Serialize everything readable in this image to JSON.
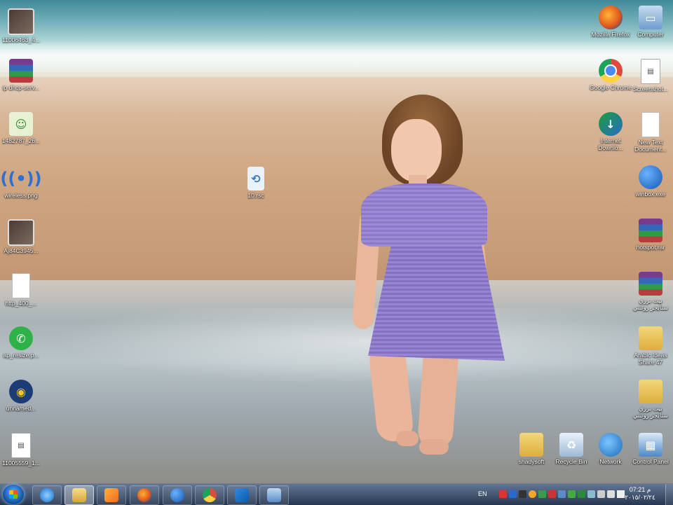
{
  "desktop_icons": {
    "left": [
      {
        "label": "11006463_4...",
        "icon": "photo-thumbnail-icon"
      },
      {
        "label": "ip dhcp-serv...",
        "icon": "winrar-archive-icon"
      },
      {
        "label": "1482787_26...",
        "icon": "png-image-icon"
      },
      {
        "label": "wireless.png",
        "icon": "wireless-image-icon"
      },
      {
        "label": "Aj84C3945...",
        "icon": "photo-thumbnail-icon"
      },
      {
        "label": "http_400_...",
        "icon": "blank-document-icon"
      },
      {
        "label": "ap_resize.p...",
        "icon": "whatsapp-icon"
      },
      {
        "label": "unnamed...",
        "icon": "wifi-app-icon"
      },
      {
        "label": "11005559_1...",
        "icon": "screenshot-file-icon"
      }
    ],
    "middle": [
      {
        "label": "10.rsc",
        "icon": "script-file-icon"
      }
    ],
    "right_col1": [
      {
        "label": "Mozilla Firefox",
        "icon": "firefox-icon"
      },
      {
        "label": "Google Chrome",
        "icon": "chrome-icon"
      },
      {
        "label": "Internet Downlo...",
        "icon": "internet-download-manager-icon"
      }
    ],
    "right_col2": [
      {
        "label": "Computer",
        "icon": "computer-icon"
      },
      {
        "label": "Screenshot...",
        "icon": "screenshot-file-icon"
      },
      {
        "label": "New Text Document...",
        "icon": "text-document-icon"
      },
      {
        "label": "winbox.exe",
        "icon": "winbox-icon"
      },
      {
        "label": "hotspot.rar",
        "icon": "winrar-archive-icon"
      },
      {
        "label": "بيت برزي ستايجر روتنتي",
        "icon": "winrar-archive-icon"
      },
      {
        "label": "Arabic Ideas Share 47",
        "icon": "folder-icon"
      },
      {
        "label": "بيت برزي ستايجر روتنتي",
        "icon": "folder-icon"
      }
    ],
    "bottom_row": [
      {
        "label": "shadysoft",
        "icon": "user-folder-icon"
      },
      {
        "label": "Recycle Bin",
        "icon": "recycle-bin-icon"
      },
      {
        "label": "Network",
        "icon": "network-icon"
      },
      {
        "label": "Control Panel",
        "icon": "control-panel-icon"
      }
    ]
  },
  "taskbar": {
    "start_icon": "windows-start-icon",
    "pinned": [
      {
        "name": "internet-explorer",
        "icon": "internet-explorer-icon",
        "active": false
      },
      {
        "name": "windows-explorer",
        "icon": "folder-explorer-icon",
        "active": true
      },
      {
        "name": "media-player",
        "icon": "media-player-icon",
        "active": false
      },
      {
        "name": "firefox",
        "icon": "firefox-icon",
        "active": false
      },
      {
        "name": "winbox",
        "icon": "winbox-icon",
        "active": false
      },
      {
        "name": "chrome",
        "icon": "chrome-icon",
        "active": false
      },
      {
        "name": "teamviewer",
        "icon": "teamviewer-icon",
        "active": false
      },
      {
        "name": "window-app",
        "icon": "window-icon",
        "active": false
      }
    ],
    "tray": {
      "language": "EN",
      "time": "07:21 م",
      "date": "٢٠١٥/٠٢/٢٤"
    }
  }
}
